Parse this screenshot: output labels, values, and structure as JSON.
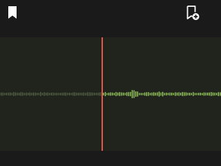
{
  "toolbar": {
    "bookmark_icon": "bookmark-icon",
    "add_bookmark_icon": "bookmark-add-icon"
  },
  "waveform": {
    "played_color": "#5a6a4a",
    "unplayed_color": "#a8e063",
    "playhead_color": "#e8574b",
    "background_color": "#21231d",
    "playhead_fraction": 0.46
  }
}
